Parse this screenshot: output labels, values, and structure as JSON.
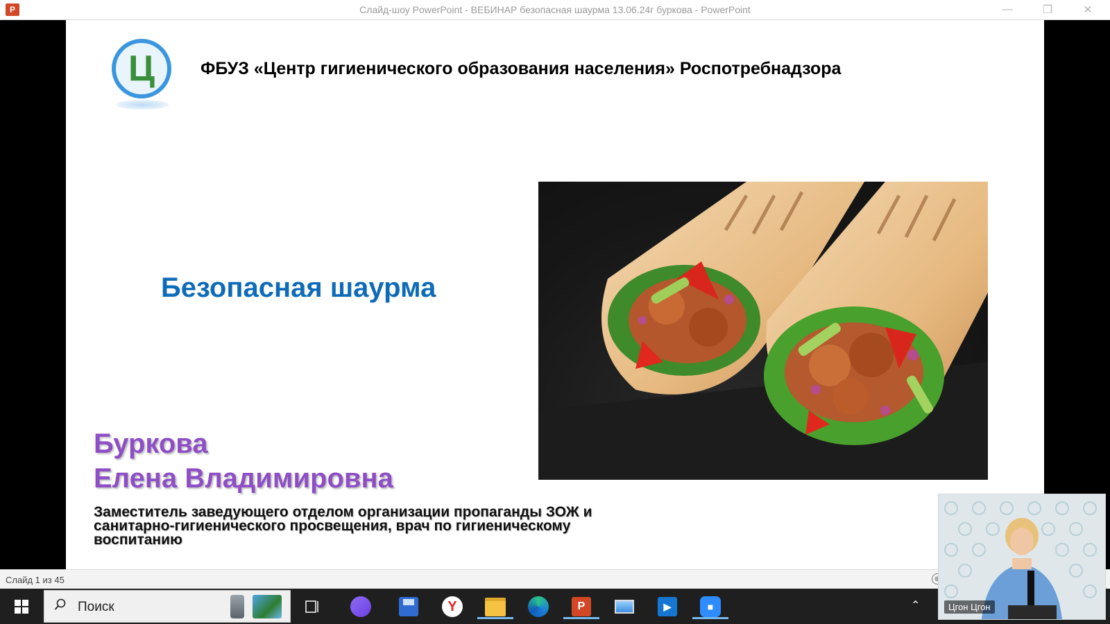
{
  "window": {
    "title": "Слайд-шоу PowerPoint  -  ВЕБИНАР  безопасная шаурма 13.06.24г буркова - PowerPoint",
    "app_icon": "powerpoint-icon",
    "app_icon_letter": "P"
  },
  "slide": {
    "org_title": "ФБУЗ «Центр гигиенического образования населения» Роспотребнадзора",
    "heading": "Безопасная шаурма",
    "author_line1": "Буркова",
    "author_line2": "Елена Владимировна",
    "position": "Заместитель заведующего отделом организации пропаганды ЗОЖ и санитарно-гигиенического просвещения, врач по гигиеническому воспитанию",
    "logo_glyph": "Ц",
    "heading_color": "#0e6bb8",
    "author_color": "#8e4fc6"
  },
  "status": {
    "slide_counter": "Слайд 1 из 45"
  },
  "taskbar": {
    "search_placeholder": "Поиск",
    "apps": [
      {
        "name": "task-view-icon"
      },
      {
        "name": "alice-assistant-icon"
      },
      {
        "name": "save-disk-icon"
      },
      {
        "name": "yandex-browser-icon"
      },
      {
        "name": "file-explorer-icon"
      },
      {
        "name": "edge-browser-icon"
      },
      {
        "name": "powerpoint-taskbar-icon"
      },
      {
        "name": "network-computer-icon"
      },
      {
        "name": "media-player-icon"
      },
      {
        "name": "zoom-icon"
      }
    ]
  },
  "webcam": {
    "participant_name": "Цгон Цгон"
  }
}
